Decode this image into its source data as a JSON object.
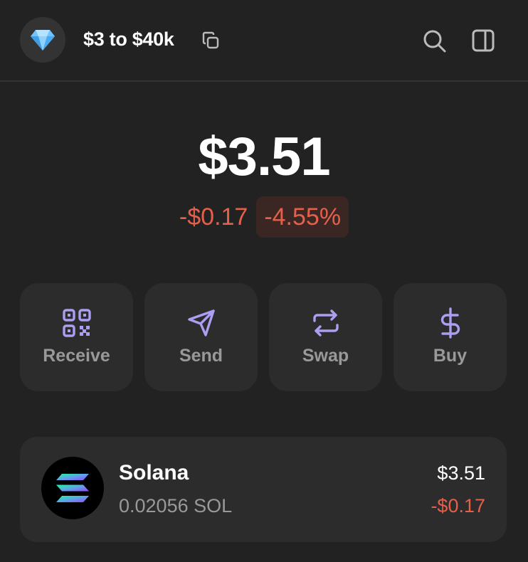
{
  "header": {
    "avatar_icon": "diamond-icon",
    "account_name": "$3 to $40k",
    "copy_icon": "copy-icon",
    "search_icon": "search-icon",
    "panel_icon": "side-panel-icon"
  },
  "balance": {
    "total": "$3.51",
    "change_value": "-$0.17",
    "change_percent": "-4.55%",
    "negative_color": "#e5604a"
  },
  "actions": [
    {
      "label": "Receive",
      "icon": "qr-code-icon"
    },
    {
      "label": "Send",
      "icon": "send-icon"
    },
    {
      "label": "Swap",
      "icon": "swap-icon"
    },
    {
      "label": "Buy",
      "icon": "dollar-icon"
    }
  ],
  "accent_color": "#ab9ff2",
  "tokens": [
    {
      "name": "Solana",
      "amount": "0.02056 SOL",
      "value": "$3.51",
      "change": "-$0.17",
      "icon": "solana-logo-icon"
    }
  ]
}
